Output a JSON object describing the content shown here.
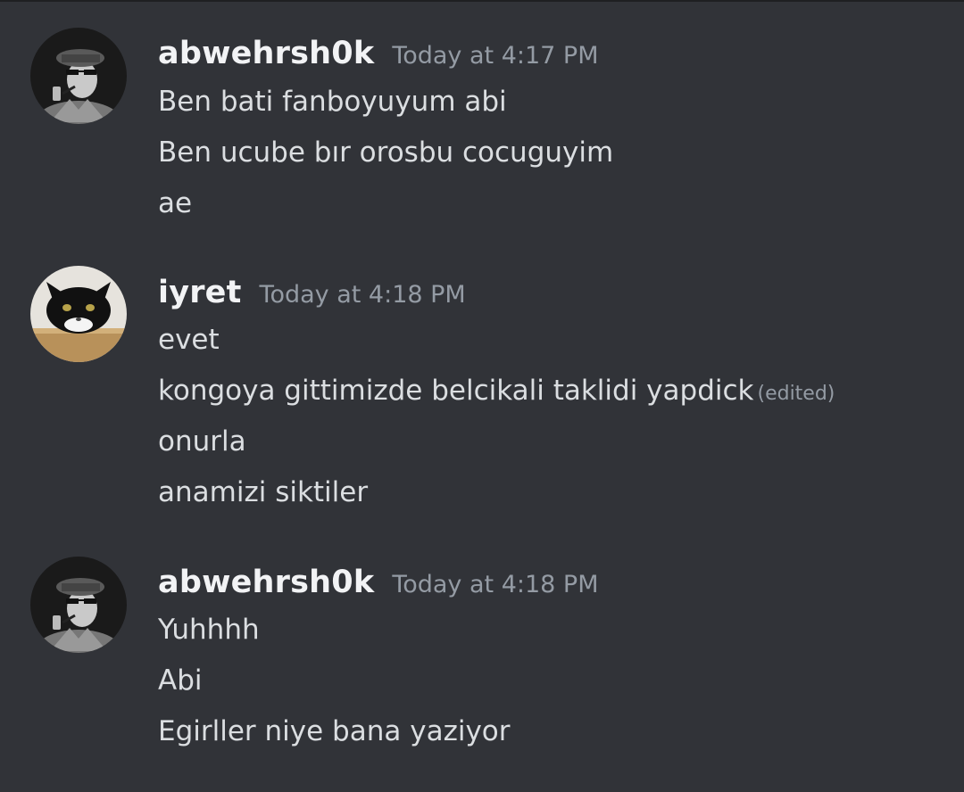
{
  "messages": [
    {
      "author": "abwehrsh0k",
      "timestamp": "Today at 4:17 PM",
      "lines": [
        "Ben bati fanboyuyum abi",
        "Ben ucube bır orosbu cocuguyim",
        "ae"
      ]
    },
    {
      "author": "iyret",
      "timestamp": "Today at 4:18 PM",
      "lines": [
        "evet",
        "kongoya gittimizde belcikali taklidi yapdick",
        "onurla",
        "anamizi siktiler"
      ],
      "edited_label": "(edited)"
    },
    {
      "author": "abwehrsh0k",
      "timestamp": "Today at 4:18 PM",
      "lines": [
        "Yuhhhh",
        "Abi",
        "Egirller niye bana yaziyor"
      ]
    }
  ],
  "colors": {
    "background": "#313338",
    "username": "#f2f3f5",
    "message_text": "#dbdee1",
    "timestamp": "#949ba4"
  },
  "icons": {
    "avatar_1": "officer-avatar-icon",
    "avatar_2": "black-cat-avatar-icon",
    "avatar_3": "officer-avatar-icon"
  }
}
